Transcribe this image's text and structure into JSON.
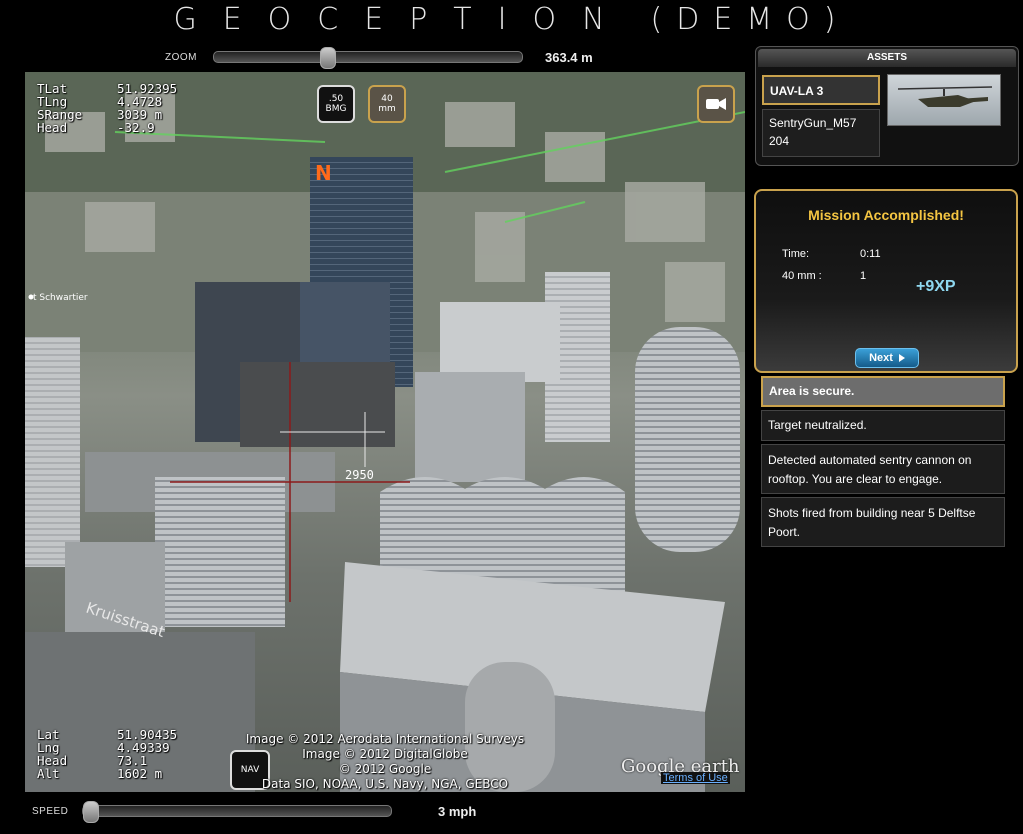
{
  "title": {
    "main": "GEOCEPTION",
    "suffix": "(DEMO)"
  },
  "zoom": {
    "label": "ZOOM",
    "value": "363.4 m",
    "level": 0.36
  },
  "speed": {
    "label": "SPEED",
    "value": "3 mph",
    "level": 0.0
  },
  "hud_top": [
    {
      "key": "TLat",
      "value": "51.92395"
    },
    {
      "key": "TLng",
      "value": "4.4728"
    },
    {
      "key": "SRange",
      "value": "3039 m"
    },
    {
      "key": "Head",
      "value": "-32.9"
    }
  ],
  "hud_bottom": [
    {
      "key": "Lat",
      "value": "51.90435"
    },
    {
      "key": "Lng",
      "value": "4.49339"
    },
    {
      "key": "Head",
      "value": "73.1"
    },
    {
      "key": "Alt",
      "value": "1602 m"
    }
  ],
  "weapons": {
    "bmg_top": ".50",
    "bmg_bottom": "BMG",
    "mm_top": "40",
    "mm_bottom": "mm"
  },
  "nav_label": "NAV",
  "target_range": "2950",
  "map_labels": {
    "street": "Kruisstraat",
    "place": "t Schwartier",
    "building_logo": "N"
  },
  "attribution": {
    "line1": "Image © 2012 Aerodata International Surveys",
    "line2": "Image © 2012 DigitalGlobe",
    "line3": "© 2012 Google",
    "line4": "Data SIO, NOAA, U.S. Navy, NGA, GEBCO",
    "brand": "Google earth",
    "terms": "Terms of Use"
  },
  "assets": {
    "header": "ASSETS",
    "items": [
      {
        "label": "UAV-LA 3",
        "selected": true
      },
      {
        "label": "SentryGun_M57 204",
        "selected": false
      }
    ]
  },
  "mission": {
    "title": "Mission Accomplished!",
    "time_label": "Time:",
    "time_value": "0:11",
    "ammo_label": "40 mm :",
    "ammo_value": "1",
    "xp": "+9XP",
    "next_label": "Next"
  },
  "log": [
    {
      "text": "Area is secure.",
      "highlight": true
    },
    {
      "text": "Target neutralized.",
      "highlight": false
    },
    {
      "text": "Detected automated sentry cannon on rooftop. You are clear to engage.",
      "highlight": false
    },
    {
      "text": "Shots fired from building near 5 Delftse Poort.",
      "highlight": false
    }
  ],
  "colors": {
    "accent_gold": "#c9a24d",
    "mission_title": "#f4c542",
    "xp": "#8fd8f0",
    "next_button": "#2a82bd"
  }
}
